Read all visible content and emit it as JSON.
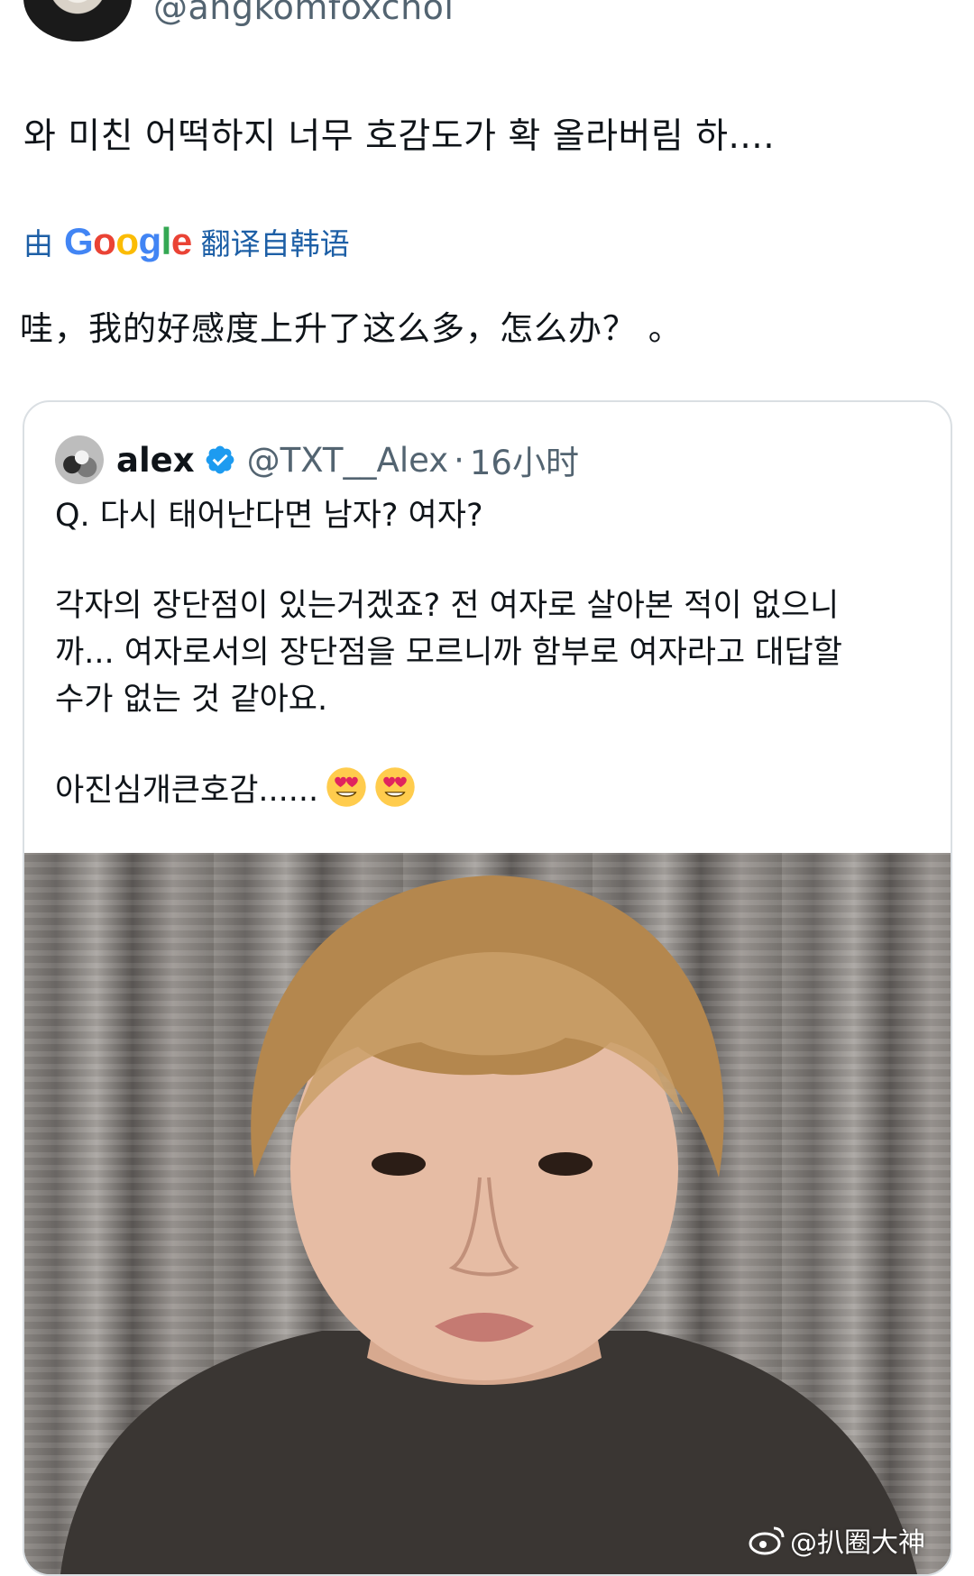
{
  "author": {
    "handle": "@angkomfoxchoi"
  },
  "tweet": {
    "text": "와 미친 어떡하지 너무 호감도가 확 올라버림 하....",
    "translation_prefix": "由",
    "translation_brand": "Google",
    "translation_suffix": "翻译自韩语",
    "translated_text": "哇，我的好感度上升了这么多，怎么办？ 。"
  },
  "quote": {
    "name": "alex",
    "handle": "@TXT__Alex",
    "separator": "·",
    "time": "16小时",
    "lines": {
      "q": "Q. 다시 태어난다면 남자? 여자?",
      "a1": "각자의 장단점이 있는거겠죠? 전 여자로 살아본 적이 없으니",
      "a2": "까... 여자로서의 장단점을 모르니까 함부로 여자라고 대답할",
      "a3": "수가 없는 것 같아요.",
      "end": "아진심개큰호감......"
    },
    "emojis": [
      "heart-eyes-emoji-icon",
      "heart-eyes-emoji-icon"
    ]
  },
  "watermark": {
    "text": "@扒圈大神"
  },
  "colors": {
    "link": "#1d5fa6",
    "verified": "#1d9bf0",
    "muted": "#536471",
    "border": "#dadfe3"
  }
}
